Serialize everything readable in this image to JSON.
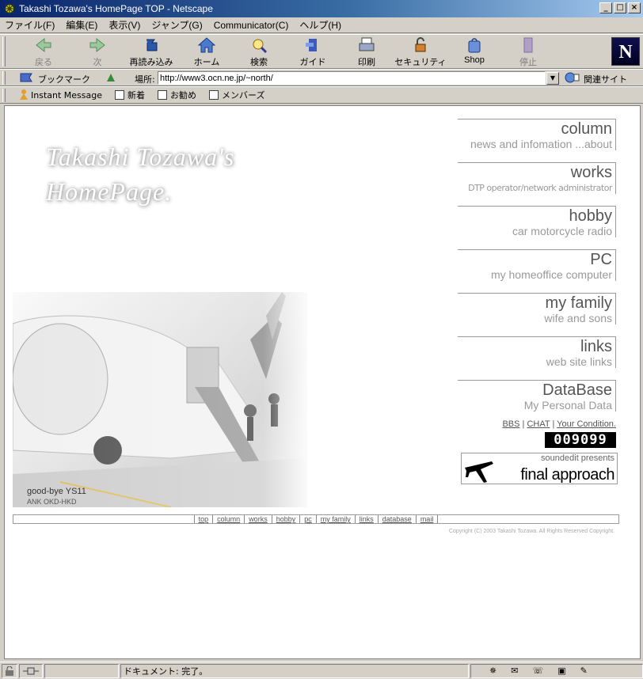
{
  "window": {
    "title": "Takashi Tozawa's HomePage TOP - Netscape",
    "buttons": {
      "minimize": "_",
      "maximize": "□",
      "close": "×"
    }
  },
  "menu": [
    "ファイル(F)",
    "編集(E)",
    "表示(V)",
    "ジャンプ(G)",
    "Communicator(C)",
    "ヘルプ(H)"
  ],
  "nav": [
    {
      "label": "戻る",
      "icon": "back-arrow-icon",
      "disabled": true
    },
    {
      "label": "次",
      "icon": "forward-arrow-icon",
      "disabled": true
    },
    {
      "label": "再読み込み",
      "icon": "reload-icon",
      "disabled": false
    },
    {
      "label": "ホーム",
      "icon": "home-icon",
      "disabled": false
    },
    {
      "label": "検索",
      "icon": "search-icon",
      "disabled": false
    },
    {
      "label": "ガイド",
      "icon": "guide-icon",
      "disabled": false
    },
    {
      "label": "印刷",
      "icon": "print-icon",
      "disabled": false
    },
    {
      "label": "セキュリティ",
      "icon": "lock-icon",
      "disabled": false
    },
    {
      "label": "Shop",
      "icon": "shop-icon",
      "disabled": false
    },
    {
      "label": "停止",
      "icon": "stop-icon",
      "disabled": true
    }
  ],
  "brand_logo": "N",
  "location": {
    "bookmark_label": "ブックマーク",
    "label": "場所:",
    "url": "http://www3.ocn.ne.jp/~north/",
    "related_label": "関連サイト"
  },
  "personal": [
    "Instant Message",
    "新着",
    "お勧め",
    "メンバーズ"
  ],
  "page": {
    "logo_line1": "Takashi Tozawa's",
    "logo_line2": "HomePage.",
    "photo_caption": "good-bye YS11",
    "photo_subcaption": "ANK OKD-HKD",
    "menu_items": [
      {
        "title": "column",
        "subtitle": "news and infomation ...about"
      },
      {
        "title": "works",
        "subtitle": "DTP operator/network administrator"
      },
      {
        "title": "hobby",
        "subtitle": "car motorcycle radio"
      },
      {
        "title": "PC",
        "subtitle": "my homeoffice computer"
      },
      {
        "title": "my family",
        "subtitle": "wife and sons"
      },
      {
        "title": "links",
        "subtitle": "web site links"
      },
      {
        "title": "DataBase",
        "subtitle": "My Personal Data"
      }
    ],
    "bbs": {
      "bbs": "BBS",
      "chat": "CHAT",
      "condition": "Your Condition."
    },
    "counter": "009099",
    "banner": {
      "sub": "soundedit presents",
      "main": "final approach"
    },
    "footer_links": [
      "top",
      "column",
      "works",
      "hobby",
      "pc",
      "my family",
      "links",
      "database",
      "mail"
    ],
    "copyright": "Copyright (C) 2003 Takashi Tozawa. All Rights Reserved Copyright."
  },
  "status": {
    "text": "ドキュメント: 完了。"
  }
}
